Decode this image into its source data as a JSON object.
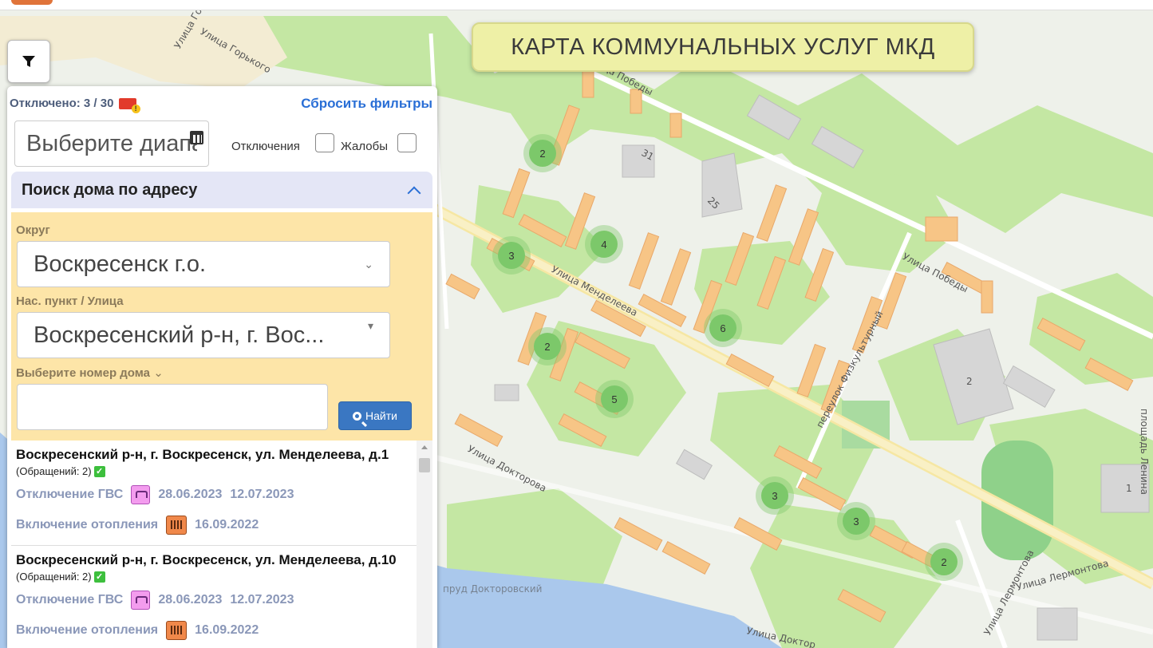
{
  "map": {
    "title": "КАРТА КОММУНАЛЬНЫХ УСЛУГ МКД",
    "streets": [
      "Улица Горького",
      "Улица Горького",
      "Улица Победы",
      "Улица Победы",
      "Улица Менделеева",
      "переулок Физкультурный",
      "Улица Докторова",
      "Улица Лермонтова",
      "Улица Лермонтова",
      "площадь Ленина",
      "пруд Докторовский",
      "Улица Доктор"
    ],
    "building_numbers": [
      "31",
      "25",
      "2",
      "1"
    ],
    "clusters": [
      "2",
      "3",
      "4",
      "6",
      "2",
      "5",
      "3",
      "3",
      "2"
    ]
  },
  "filter_button": {
    "icon": "filter-icon"
  },
  "panel": {
    "disabled_label": "Отключено: 3 / 30",
    "reset_filters": "Сбросить фильтры",
    "date_placeholder": "Выберите диапазон",
    "outages_label": "Отключения",
    "complaints_label": "Жалобы",
    "search_section_title": "Поиск дома по адресу",
    "district_label": "Округ",
    "district_value": "Воскресенск г.о.",
    "locality_label": "Нас. пункт / Улица",
    "locality_value": "Воскресенский р-н, г. Вос...",
    "house_number_label": "Выберите номер дома",
    "house_number_value": "",
    "find_button": "Найти"
  },
  "results": [
    {
      "address": "Воскресенский р-н, г. Воскресенск, ул. Менделеева, д.1",
      "appeals": "(Обращений: 2)",
      "gvs_label": "Отключение ГВС",
      "gvs_from": "28.06.2023",
      "gvs_to": "12.07.2023",
      "heat_label": "Включение отопления",
      "heat_date": "16.09.2022"
    },
    {
      "address": "Воскресенский р-н, г. Воскресенск, ул. Менделеева, д.10",
      "appeals": "(Обращений: 2)",
      "gvs_label": "Отключение ГВС",
      "gvs_from": "28.06.2023",
      "gvs_to": "12.07.2023",
      "heat_label": "Включение отопления",
      "heat_date": "16.09.2022"
    }
  ],
  "colors": {
    "map_land": "#eef1ea",
    "park_green": "#c4e7a3",
    "water": "#aac8ec",
    "building": "#f7c586",
    "cluster": "#7cc86a",
    "accent_blue": "#2a6fd6",
    "title_bg": "#eef0a6",
    "search_bg": "#fde5a8"
  }
}
